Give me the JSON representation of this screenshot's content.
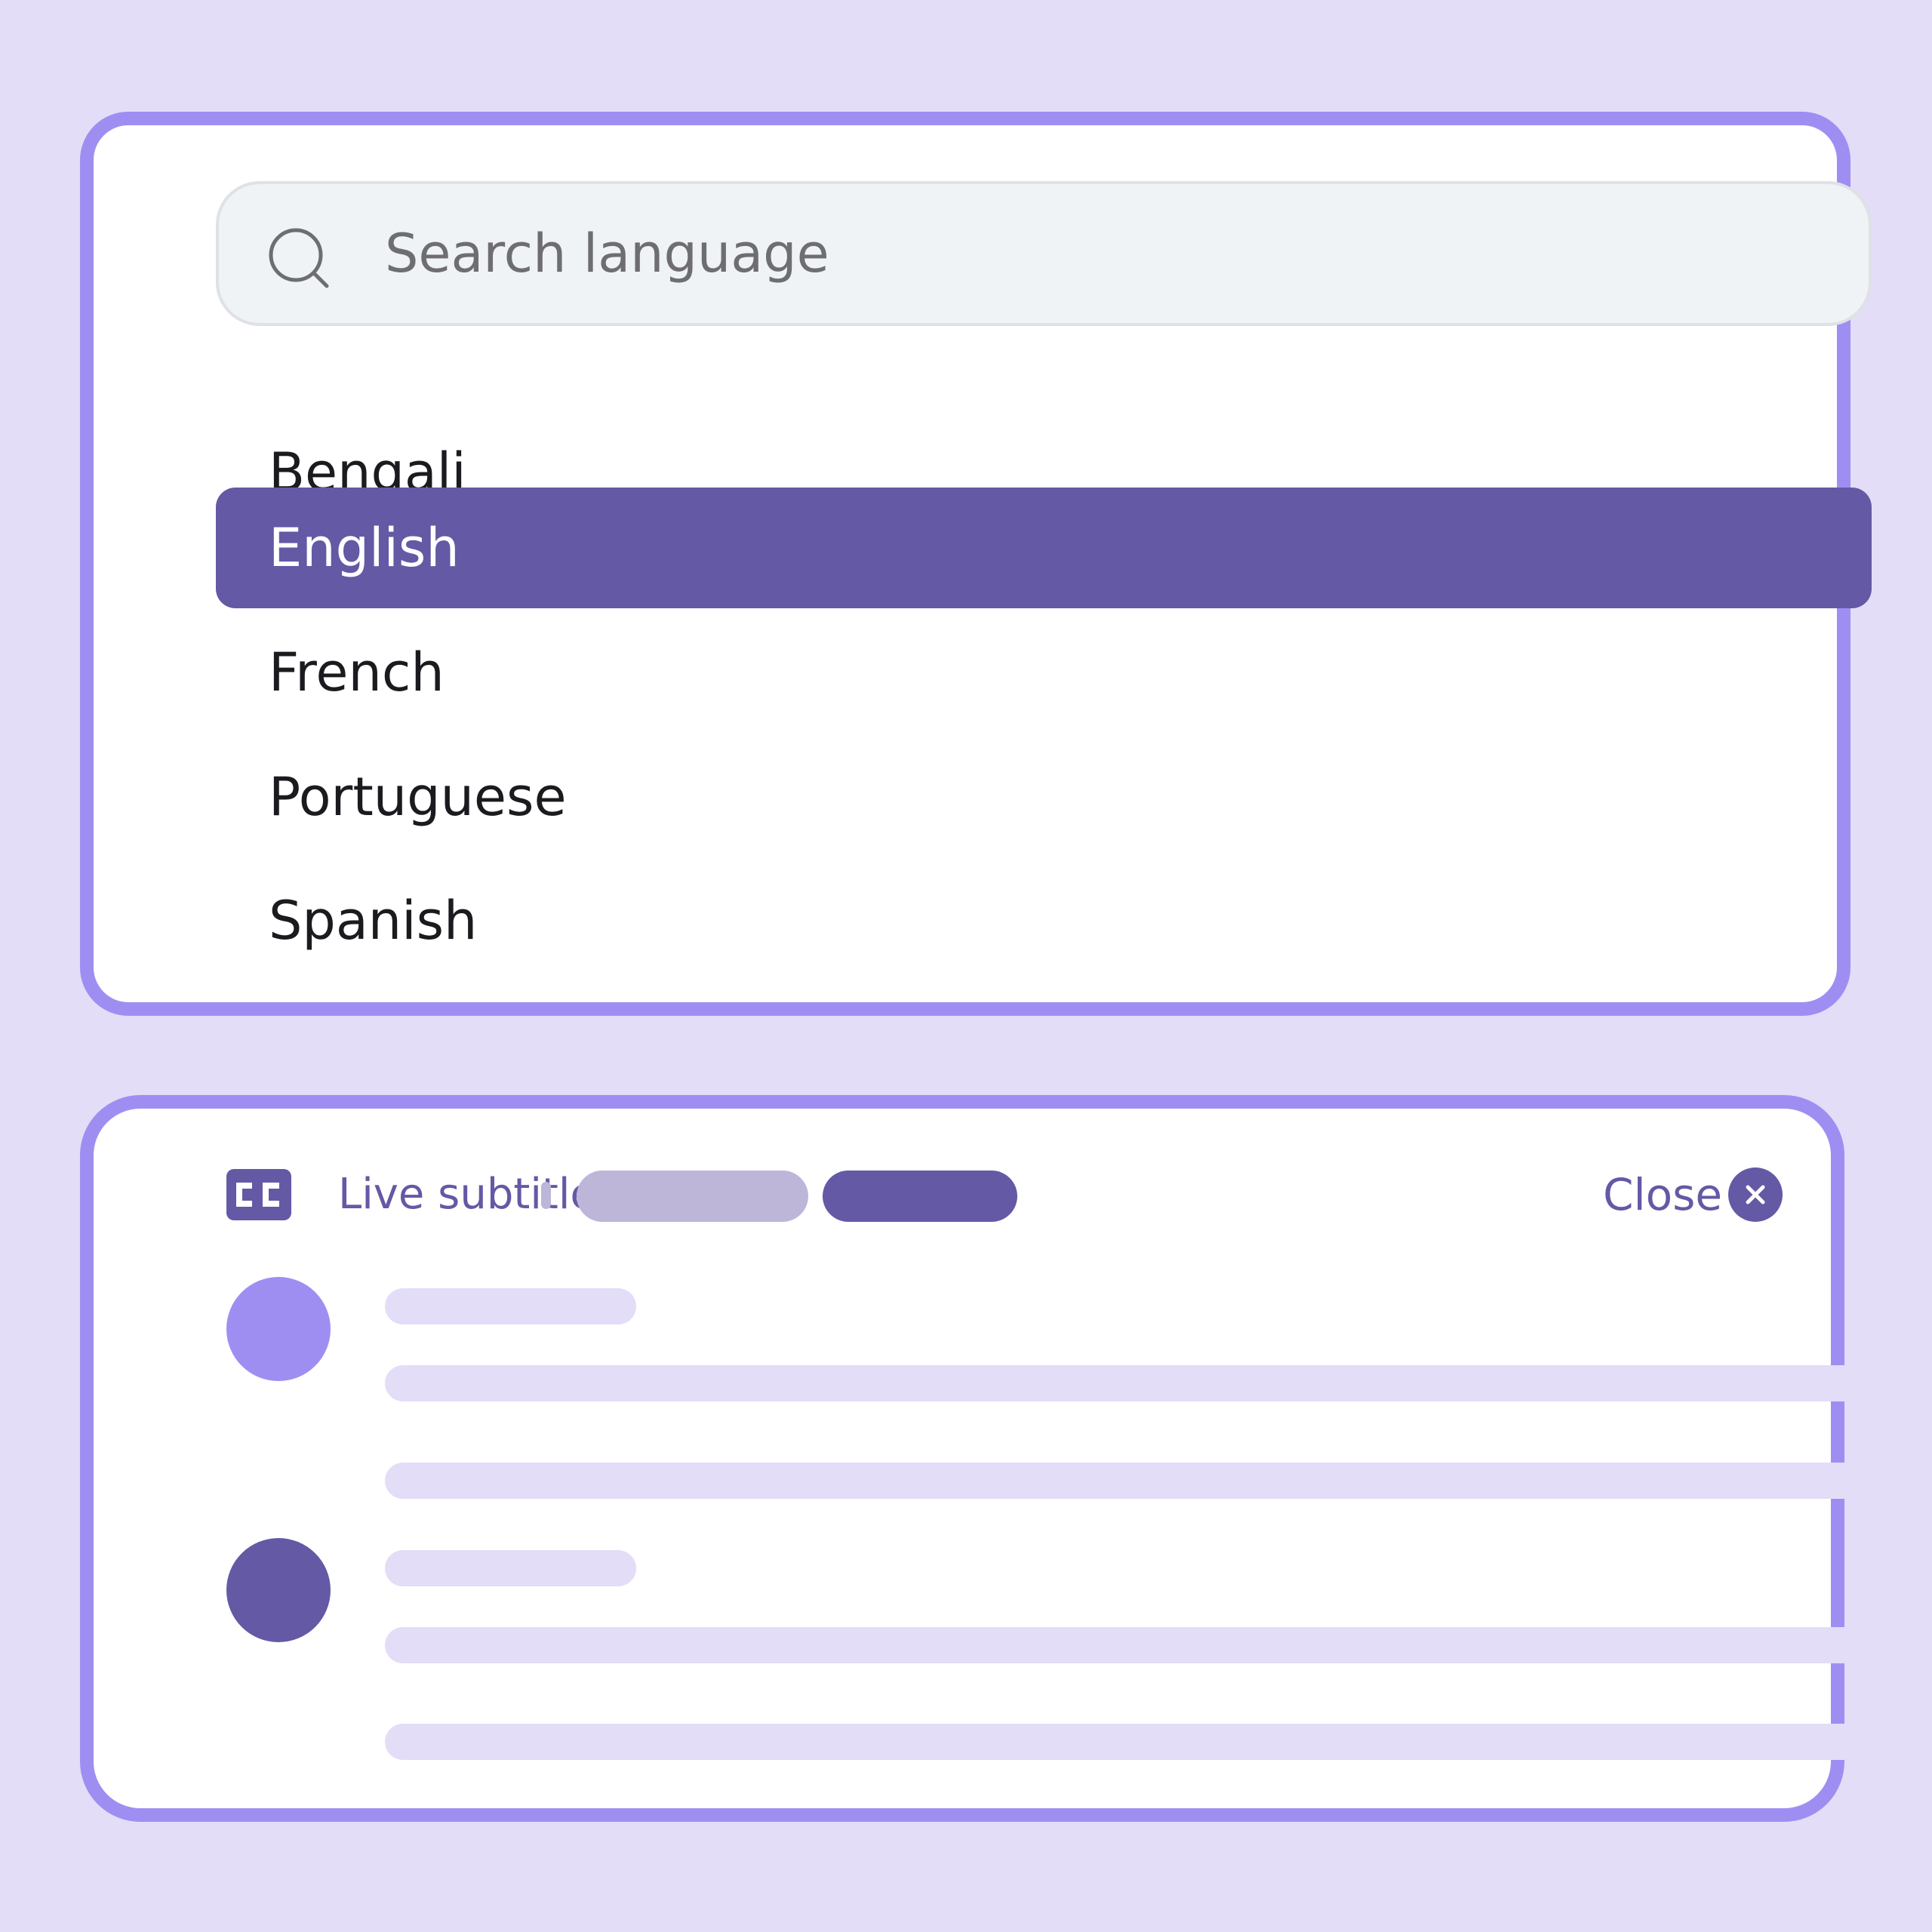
{
  "language_picker": {
    "search": {
      "placeholder": "Search language",
      "icon": "search-icon"
    },
    "languages": [
      {
        "label": "Bengali",
        "selected": false
      },
      {
        "label": "English",
        "selected": true
      },
      {
        "label": "French",
        "selected": false
      },
      {
        "label": "Portuguese",
        "selected": false
      },
      {
        "label": "Spanish",
        "selected": false
      }
    ]
  },
  "subtitle_panel": {
    "icon": "closed-captions-icon",
    "title": "Live subtitle",
    "close_label": "Close",
    "close_icon": "close-icon",
    "messages": [
      {
        "avatar_color": "#9f8ef2"
      },
      {
        "avatar_color": "#6459a5"
      }
    ]
  },
  "colors": {
    "background": "#e3ddf7",
    "panel_border": "#9f8ef2",
    "accent": "#6459a5",
    "accent_light": "#bdb6d9",
    "placeholder_line": "#e3ddf7",
    "search_field": "#eff3f6"
  }
}
